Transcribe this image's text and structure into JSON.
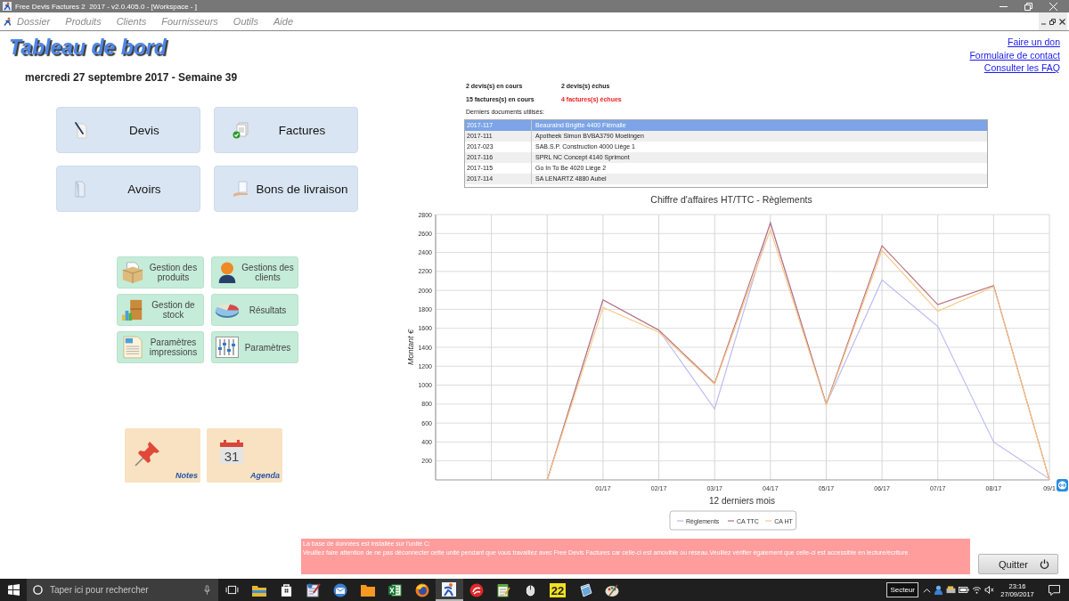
{
  "window": {
    "title": "Free Devis Factures 2  2017 - v2.0.405.0 - [Workspace - ]"
  },
  "menu": [
    "Dossier",
    "Produits",
    "Clients",
    "Fournisseurs",
    "Outils",
    "Aide"
  ],
  "dashboard": {
    "title": "Tableau de bord",
    "date": "mercredi 27 septembre 2017 - Semaine 39"
  },
  "main_buttons": [
    {
      "label": "Devis",
      "kind": "quote"
    },
    {
      "label": "Factures",
      "kind": "invoice"
    },
    {
      "label": "Avoirs",
      "kind": "credit"
    },
    {
      "label": "Bons de livraison",
      "kind": "delivery"
    }
  ],
  "management_buttons": [
    {
      "label": "Gestion des produits",
      "kind": "products"
    },
    {
      "label": "Gestions des clients",
      "kind": "clients"
    },
    {
      "label": "Gestion de stock",
      "kind": "stock"
    },
    {
      "label": "Résultats",
      "kind": "results"
    },
    {
      "label": "Paramètres impressions",
      "kind": "print"
    },
    {
      "label": "Paramètres",
      "kind": "settings"
    }
  ],
  "tiles": [
    {
      "label": "Notes",
      "kind": "notes"
    },
    {
      "label": "Agenda",
      "kind": "agenda",
      "icon_text": "31"
    }
  ],
  "links": [
    "Faire un don",
    "Formulaire de contact",
    "Consulter les FAQ"
  ],
  "stats": [
    {
      "text": "2 devis(s) en cours",
      "alert": false
    },
    {
      "text": "2 devis(s) échus",
      "alert": false
    },
    {
      "text": "15 factures(s) en cours",
      "alert": false
    },
    {
      "text": "4 factures(s) échues",
      "alert": true
    }
  ],
  "recent_documents": {
    "label": "Derniers documents utilisés:",
    "rows": [
      {
        "number": "2017-117",
        "client": "Beauraind Brigitte 4400 Flémalle",
        "selected": true
      },
      {
        "number": "2017-111",
        "client": "Apotheek Simon BVBA3790 Moelingen",
        "selected": false
      },
      {
        "number": "2017-023",
        "client": "SAB.S.P. Construction 4000 Liège 1",
        "selected": false
      },
      {
        "number": "2017-116",
        "client": "SPRL NC Concept 4140 Sprimont",
        "selected": false
      },
      {
        "number": "2017-115",
        "client": "Go In To Be 4020 Liège 2",
        "selected": false
      },
      {
        "number": "2017-114",
        "client": "SA LENARTZ 4880 Aubel",
        "selected": false
      }
    ]
  },
  "chart": {
    "chart_data": {
      "type": "line",
      "title": "Chiffre d'affaires HT/TTC - Règlements",
      "xlabel": "12 derniers mois",
      "ylabel": "Montant €",
      "categories": [
        null,
        null,
        null,
        "01/17",
        "02/17",
        "03/17",
        "04/17",
        "05/17",
        "06/17",
        "07/17",
        "08/17",
        "09/1"
      ],
      "ylim": [
        0,
        2800
      ],
      "yticks": [
        200,
        400,
        600,
        800,
        1000,
        1200,
        1400,
        1600,
        1800,
        2000,
        2200,
        2400,
        2600,
        2800
      ],
      "grid": true,
      "legend": "bottom",
      "series": [
        {
          "name": "Règlements",
          "color": "#b8b8f0",
          "values": [
            null,
            null,
            0,
            1900,
            1580,
            750,
            2720,
            800,
            2110,
            1620,
            400,
            10
          ]
        },
        {
          "name": "CA TTC",
          "color": "#b86e7c",
          "values": [
            null,
            null,
            0,
            1900,
            1580,
            1020,
            2710,
            800,
            2470,
            1850,
            2050,
            0
          ]
        },
        {
          "name": "CA HT",
          "color": "#f8c682",
          "values": [
            null,
            null,
            0,
            1820,
            1560,
            1010,
            2640,
            790,
            2420,
            1780,
            2040,
            0
          ]
        }
      ]
    }
  },
  "notice": {
    "lines": [
      "La base de données est installée sur l'unité C:",
      "Veuillez faire attention de ne pas déconnecter cette unité pendant que vous travaillez avec Free Devis Factures car celle-ci est amovible ou réseau.Veuillez vérifier également que celle-ci est accessible en lecture/écriture."
    ]
  },
  "quit_button": {
    "label": "Quitter"
  },
  "taskbar": {
    "search": {
      "placeholder": "Taper ici pour rechercher"
    },
    "apps": [
      {
        "kind": "explorer",
        "active": false
      },
      {
        "kind": "store",
        "active": false
      },
      {
        "kind": "editor",
        "active": false
      },
      {
        "kind": "mail",
        "active": false
      },
      {
        "kind": "folder",
        "active": false
      },
      {
        "kind": "spreadsheet",
        "active": false
      },
      {
        "kind": "browser",
        "active": false
      },
      {
        "kind": "runner",
        "active": true
      },
      {
        "kind": "swirl",
        "active": false
      },
      {
        "kind": "notepad",
        "active": false
      },
      {
        "kind": "mouse",
        "active": false
      },
      {
        "kind": "number",
        "text": "22",
        "active": false
      },
      {
        "kind": "book",
        "active": false
      },
      {
        "kind": "palette",
        "active": false
      }
    ],
    "tooltip": "Secteur",
    "time": "23:16",
    "date": "27/09/2017"
  }
}
